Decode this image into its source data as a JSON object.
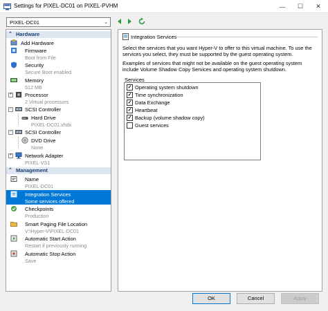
{
  "window": {
    "title": "Settings for PIXEL-DC01 on PIXEL-PVHM",
    "minimize": "—",
    "maximize": "☐",
    "close": "✕"
  },
  "toolbar": {
    "vm_selected": "PIXEL-DC01"
  },
  "sidebar": {
    "hardware_header": "Hardware",
    "management_header": "Management",
    "items": [
      {
        "label": "Add Hardware",
        "sub": ""
      },
      {
        "label": "Firmware",
        "sub": "Boot from File"
      },
      {
        "label": "Security",
        "sub": "Secure Boot enabled"
      },
      {
        "label": "Memory",
        "sub": "512 MB"
      },
      {
        "label": "Processor",
        "sub": "2 Virtual processors"
      },
      {
        "label": "SCSI Controller",
        "sub": ""
      },
      {
        "label": "Hard Drive",
        "sub": "PIXEL-DC01.vhdx"
      },
      {
        "label": "SCSI Controller",
        "sub": ""
      },
      {
        "label": "DVD Drive",
        "sub": "None"
      },
      {
        "label": "Network Adapter",
        "sub": "PIXEL-VS1"
      },
      {
        "label": "Name",
        "sub": "PIXEL-DC01"
      },
      {
        "label": "Integration Services",
        "sub": "Some services offered"
      },
      {
        "label": "Checkpoints",
        "sub": "Production"
      },
      {
        "label": "Smart Paging File Location",
        "sub": "V:\\Hyper-V\\PIXEL-DC01"
      },
      {
        "label": "Automatic Start Action",
        "sub": "Restart if previously running"
      },
      {
        "label": "Automatic Stop Action",
        "sub": "Save"
      }
    ]
  },
  "main": {
    "section_title": "Integration Services",
    "para1": "Select the services that you want Hyper-V to offer to this virtual machine. To use the services you select, they must be supported by the guest operating system.",
    "para2": "Examples of services that might not be available on the guest operating system include Volume Shadow Copy Services and operating system shutdown.",
    "services_label": "Services",
    "services": [
      {
        "label": "Operating system shutdown",
        "checked": true
      },
      {
        "label": "Time synchronization",
        "checked": true
      },
      {
        "label": "Data Exchange",
        "checked": true
      },
      {
        "label": "Heartbeat",
        "checked": true
      },
      {
        "label": "Backup (volume shadow copy)",
        "checked": true
      },
      {
        "label": "Guest services",
        "checked": false
      }
    ]
  },
  "buttons": {
    "ok": "OK",
    "cancel": "Cancel",
    "apply": "Apply"
  },
  "colors": {
    "selection": "#0078d7",
    "section_header_bg": "#dee7f1"
  }
}
